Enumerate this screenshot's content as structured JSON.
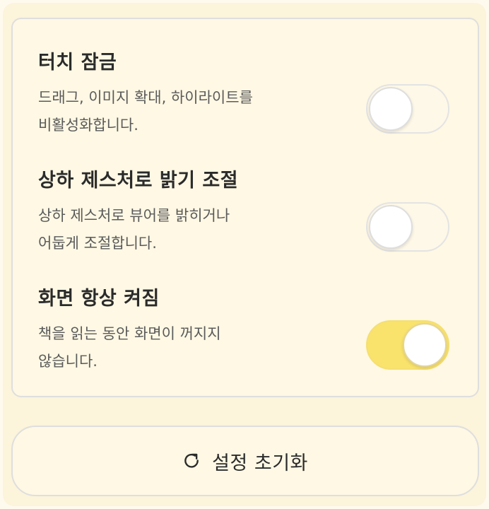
{
  "settings": [
    {
      "title": "터치 잠금",
      "description": "드래그, 이미지 확대, 하이라이트를\n비활성화합니다.",
      "enabled": false
    },
    {
      "title": "상하 제스처로 밝기 조절",
      "description": "상하 제스처로 뷰어를 밝히거나\n어둡게 조절합니다.",
      "enabled": false
    },
    {
      "title": "화면 항상 켜짐",
      "description": "책을 읽는 동안 화면이 꺼지지\n않습니다.",
      "enabled": true
    }
  ],
  "reset": {
    "label": "설정 초기화",
    "icon": "refresh-icon"
  },
  "colors": {
    "toggle_on": "#f9e36c",
    "toggle_off": "#fef8e8",
    "background": "#fcf4db"
  }
}
